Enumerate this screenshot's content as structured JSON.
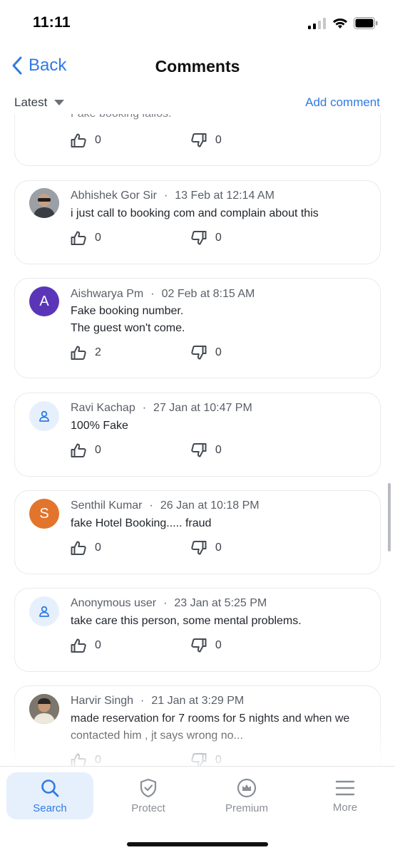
{
  "status": {
    "time": "11:11"
  },
  "nav": {
    "back_label": "Back",
    "title": "Comments"
  },
  "toolbar": {
    "sort_label": "Latest",
    "add_comment_label": "Add comment"
  },
  "comments": [
    {
      "name": "",
      "date": "",
      "text": "Fake booking lallos.",
      "likes": "0",
      "dislikes": "0"
    },
    {
      "name": "Abhishek Gor Sir",
      "date": "13 Feb at 12:14 AM",
      "text": "i just call to booking com and complain about this",
      "likes": "0",
      "dislikes": "0"
    },
    {
      "name": "Aishwarya Pm",
      "date": "02 Feb at 8:15 AM",
      "text": "Fake booking number.\nThe guest won't come.",
      "avatar_letter": "A",
      "likes": "2",
      "dislikes": "0"
    },
    {
      "name": "Ravi Kachap",
      "date": "27 Jan at 10:47 PM",
      "text": "100% Fake",
      "likes": "0",
      "dislikes": "0"
    },
    {
      "name": "Senthil Kumar",
      "date": "26 Jan at 10:18 PM",
      "text": "fake Hotel Booking..... fraud",
      "avatar_letter": "S",
      "likes": "0",
      "dislikes": "0"
    },
    {
      "name": "Anonymous user",
      "date": "23 Jan at 5:25 PM",
      "text": "take care this person, some mental problems.",
      "likes": "0",
      "dislikes": "0"
    },
    {
      "name": "Harvir Singh",
      "date": "21 Jan at 3:29 PM",
      "text": "made reservation for 7 rooms for 5 nights and when we contacted him , jt says wrong no...",
      "likes": "0",
      "dislikes": "0"
    }
  ],
  "tabs": [
    {
      "label": "Search",
      "icon": "search-icon",
      "active": true
    },
    {
      "label": "Protect",
      "icon": "shield-icon",
      "active": false
    },
    {
      "label": "Premium",
      "icon": "crown-icon",
      "active": false
    },
    {
      "label": "More",
      "icon": "menu-icon",
      "active": false
    }
  ],
  "colors": {
    "accent": "#2f7ae5",
    "avatar_purple": "#5b35b8",
    "avatar_orange": "#e2742c",
    "avatar_placeholder": "#e6f0fc",
    "card_border": "#e8eaee"
  }
}
